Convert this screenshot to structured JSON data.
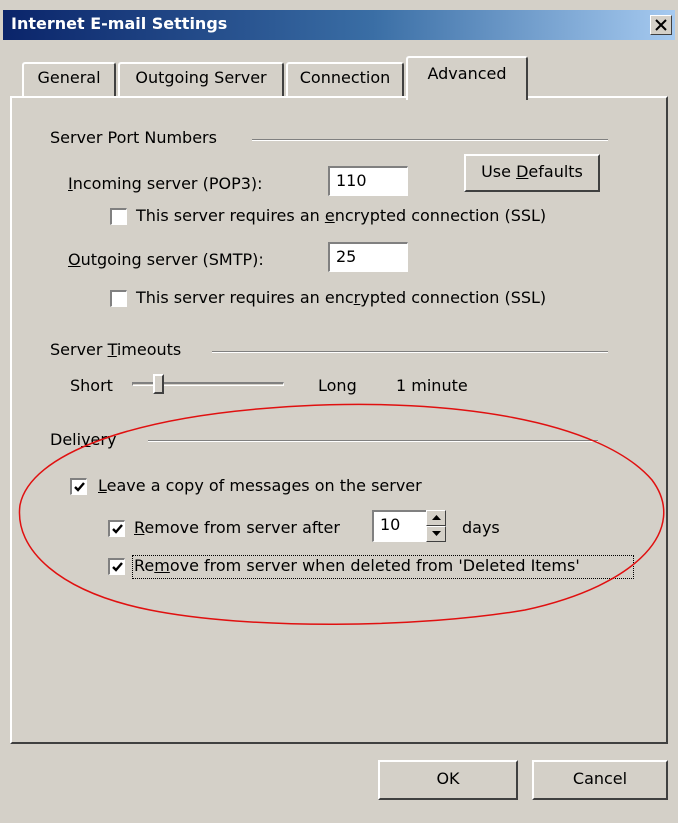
{
  "window": {
    "title": "Internet E-mail Settings",
    "close_glyph": "close-x-icon"
  },
  "tabs": [
    {
      "label": "General",
      "active": false
    },
    {
      "label": "Outgoing Server",
      "active": false
    },
    {
      "label": "Connection",
      "active": false
    },
    {
      "label": "Advanced",
      "active": true
    }
  ],
  "server_ports": {
    "group_label": "Server Port Numbers",
    "incoming_label_pre": "",
    "incoming_label_key": "I",
    "incoming_label_post": "ncoming server (POP3):",
    "incoming_value": "110",
    "incoming_ssl_pre": "This server requires an ",
    "incoming_ssl_key": "e",
    "incoming_ssl_post": "ncrypted connection (SSL)",
    "incoming_ssl_checked": false,
    "use_defaults_pre": "Use ",
    "use_defaults_key": "D",
    "use_defaults_post": "efaults",
    "outgoing_label_key": "O",
    "outgoing_label_post": "utgoing server (SMTP):",
    "outgoing_value": "25",
    "outgoing_ssl_pre": "This server requires an enc",
    "outgoing_ssl_key": "r",
    "outgoing_ssl_post": "ypted connection (SSL)",
    "outgoing_ssl_checked": false
  },
  "timeouts": {
    "group_label_pre": "Server ",
    "group_label_key": "T",
    "group_label_post": "imeouts",
    "short_label": "Short",
    "long_label": "Long",
    "value_label": "1 minute",
    "slider_position": 0.15
  },
  "delivery": {
    "group_label_pre": "Deli",
    "group_label_key": "v",
    "group_label_post": "ery",
    "leave_copy_key": "L",
    "leave_copy_post": "eave a copy of messages on the server",
    "leave_copy_checked": true,
    "remove_after_key": "R",
    "remove_after_post": "emove from server after",
    "remove_after_checked": true,
    "days_value": "10",
    "days_label": "days",
    "remove_deleted_key": "m",
    "remove_deleted_pre": "Re",
    "remove_deleted_post": "ove from server when deleted from 'Deleted Items'",
    "remove_deleted_checked": true
  },
  "buttons": {
    "ok_label": "OK",
    "cancel_label": "Cancel"
  },
  "colors": {
    "dialog_bg": "#d4d0c8",
    "title_gradient_start": "#0a246a",
    "title_gradient_end": "#a6caf0",
    "annotation": "#e01010"
  }
}
